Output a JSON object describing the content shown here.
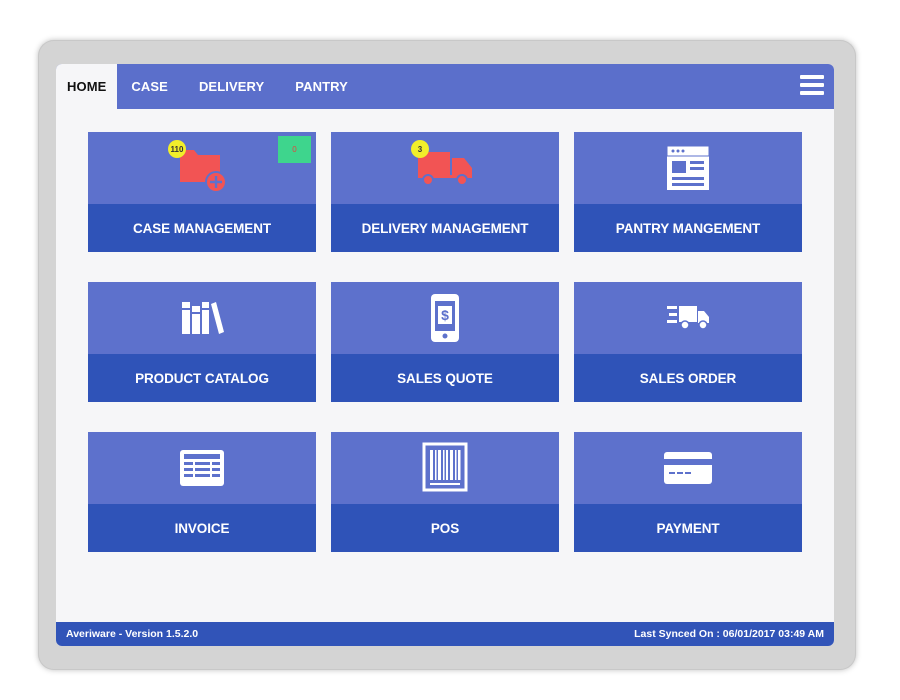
{
  "tabs": [
    {
      "label": "HOME",
      "active": true
    },
    {
      "label": "CASE",
      "active": false
    },
    {
      "label": "DELIVERY",
      "active": false
    },
    {
      "label": "PANTRY",
      "active": false
    }
  ],
  "menu_icon": "hamburger-menu-icon",
  "tiles": [
    {
      "label": "CASE MANAGEMENT",
      "icon": "folder-add-icon",
      "badge": "110",
      "secondary_badge": "0"
    },
    {
      "label": "DELIVERY MANAGEMENT",
      "icon": "truck-icon",
      "badge": "3"
    },
    {
      "label": "PANTRY MANGEMENT",
      "icon": "browser-window-icon"
    },
    {
      "label": "PRODUCT CATALOG",
      "icon": "books-icon"
    },
    {
      "label": "SALES QUOTE",
      "icon": "mobile-dollar-icon"
    },
    {
      "label": "SALES ORDER",
      "icon": "fast-delivery-icon"
    },
    {
      "label": "INVOICE",
      "icon": "invoice-icon"
    },
    {
      "label": "POS",
      "icon": "barcode-icon"
    },
    {
      "label": "PAYMENT",
      "icon": "credit-card-icon"
    }
  ],
  "footer": {
    "version": "Averiware - Version 1.5.2.0",
    "synced": "Last Synced On : 06/01/2017 03:49 AM"
  },
  "colors": {
    "header": "#5b6fcb",
    "tile_top": "#5d71cc",
    "tile_bottom": "#2f53b8",
    "footer": "#3154b8",
    "icon_red": "#f25454",
    "badge_yellow": "#f1ef2a",
    "badge_green": "#3ed58d"
  }
}
